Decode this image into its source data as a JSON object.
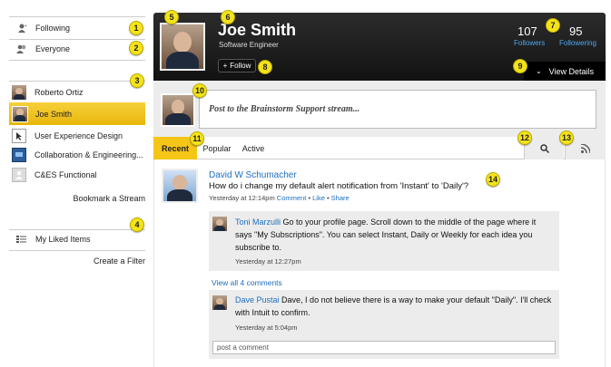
{
  "sidebar": {
    "filters": [
      {
        "label": "Following",
        "icon": "person-plus-icon"
      },
      {
        "label": "Everyone",
        "icon": "people-icon"
      }
    ],
    "streams": [
      {
        "label": "Roberto Ortiz"
      },
      {
        "label": "Joe Smith"
      },
      {
        "label": "User Experience Design"
      },
      {
        "label": "Collaboration & Engineering..."
      },
      {
        "label": "C&ES Functional"
      }
    ],
    "bookmark_label": "Bookmark a Stream",
    "liked_label": "My Liked Items",
    "create_filter_label": "Create a Filter",
    "selected_color": "#f0c419"
  },
  "profile": {
    "name": "Joe Smith",
    "title": "Software Engineer",
    "follow_label": "Follow",
    "followers_count": "107",
    "followers_label": "Followers",
    "following_count": "95",
    "following_label": "Followering",
    "view_details_label": "View Details"
  },
  "post_box": {
    "placeholder": "Post to the Brainstorm Support stream..."
  },
  "tabs": {
    "recent": "Recent",
    "popular": "Popular",
    "active": "Active"
  },
  "feed": {
    "author": "David W Schumacher",
    "question": "How do i change my default alert notification from 'Instant' to 'Daily'?",
    "time": "Yesterday at 12:14pm",
    "comment_link": "Comment",
    "like_link": "Like",
    "share_link": "Share",
    "sep": " • ",
    "replies": [
      {
        "author": "Toni Marzulli",
        "text": "Go to your profile page.  Scroll down to the middle of the page where it says \"My Subscriptions\".  You can select Instant, Daily or Weekly for each idea you subscribe to.",
        "time": "Yesterday at 12:27pm"
      },
      {
        "author": "Dave Pustai",
        "text": "Dave, I do not believe there is a way to make your default \"Daily\".  I'll check with Intuit to confirm.",
        "time": "Yesterday at 5:04pm"
      }
    ],
    "view_all": "View all 4 comments",
    "comment_placeholder": "post a comment"
  },
  "badges": [
    "1",
    "2",
    "3",
    "4",
    "5",
    "6",
    "7",
    "8",
    "9",
    "10",
    "11",
    "12",
    "13",
    "14"
  ],
  "colors": {
    "header_bg": "#1e1e1e",
    "accent": "#f5e31a",
    "link": "#1d6fbf"
  }
}
